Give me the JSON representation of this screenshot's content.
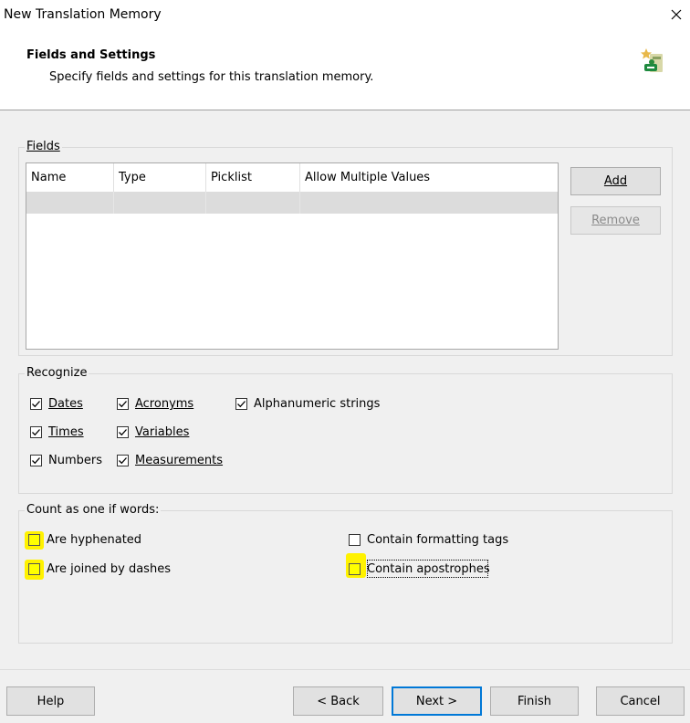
{
  "window": {
    "title": "New Translation Memory"
  },
  "header": {
    "title": "Fields and Settings",
    "subtitle": "Specify fields and settings for this translation memory."
  },
  "fields": {
    "group_label": "Fields",
    "columns": [
      "Name",
      "Type",
      "Picklist",
      "Allow Multiple Values"
    ],
    "add_label": "Add",
    "remove_label": "Remove"
  },
  "recognize": {
    "group_label": "Recognize",
    "items": [
      {
        "label": "Dates",
        "checked": true
      },
      {
        "label": "Times",
        "checked": true
      },
      {
        "label": "Numbers",
        "checked": true
      },
      {
        "label": "Acronyms",
        "checked": true
      },
      {
        "label": "Variables",
        "checked": true
      },
      {
        "label": "Measurements",
        "checked": true
      },
      {
        "label": "Alphanumeric strings",
        "checked": true
      }
    ]
  },
  "count": {
    "group_label": "Count as one if words:",
    "items": [
      {
        "label": "Are hyphenated",
        "checked": false
      },
      {
        "label": "Are joined by dashes",
        "checked": false
      },
      {
        "label": "Contain formatting tags",
        "checked": false
      },
      {
        "label": "Contain apostrophes",
        "checked": false
      }
    ]
  },
  "footer": {
    "help": "Help",
    "back": "< Back",
    "next": "Next >",
    "finish": "Finish",
    "cancel": "Cancel"
  },
  "colors": {
    "highlight": "#fff200",
    "accent": "#0078d7"
  }
}
